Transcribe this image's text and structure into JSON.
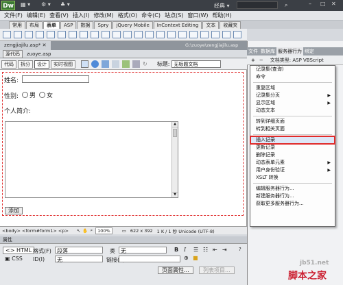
{
  "app": {
    "logo": "Dw",
    "workspace": "经典 ▾"
  },
  "menu": [
    "文件(F)",
    "编辑(E)",
    "查看(V)",
    "插入(I)",
    "修改(M)",
    "格式(O)",
    "命令(C)",
    "站点(S)",
    "窗口(W)",
    "帮助(H)"
  ],
  "insert_tabs": [
    "常用",
    "布局",
    "表单",
    "ASP",
    "数据",
    "Spry",
    "jQuery Mobile",
    "InContext Editing",
    "文本",
    "收藏夹"
  ],
  "active_insert_tab": "表单",
  "doc_tab": "zengjiajilu.asp*",
  "doc_path": "G:\\zuoye\\zengjiajilu.asp",
  "related_files": [
    "源代码",
    "zuoye.asp"
  ],
  "view_buttons": [
    "代码",
    "拆分",
    "设计",
    "实时视图"
  ],
  "title_label": "标题:",
  "title_value": "无标题文档",
  "form": {
    "name_label": "姓名:",
    "gender_label": "性别:",
    "male": "男",
    "female": "女",
    "intro_label": "个人简介:",
    "submit": "添加"
  },
  "status": {
    "tags": "<body> <form#form1> <p>",
    "zoom": "100%",
    "size": "622 x 392",
    "info": "1 K / 1 秒 Unicode (UTF-8)"
  },
  "props": {
    "header": "属性",
    "html": "HTML",
    "css": "CSS",
    "format_label": "格式(F)",
    "format_value": "段落",
    "class_label": "类",
    "class_value": "无",
    "id_label": "ID(I)",
    "id_value": "无",
    "link_label": "链接(L)",
    "page_props": "页面属性...",
    "list_item": "列表项目..."
  },
  "panel_tabs": [
    "文件",
    "数据库",
    "服务器行为",
    "绑定"
  ],
  "panel_doc_type": "文档类型: ASP VBScript",
  "context_menu": [
    {
      "label": "记录集(查询)"
    },
    {
      "label": "命令"
    },
    {
      "sep": true
    },
    {
      "label": "重复区域"
    },
    {
      "label": "记录集分页",
      "sub": true
    },
    {
      "label": "显示区域",
      "sub": true
    },
    {
      "label": "动态文本"
    },
    {
      "sep": true
    },
    {
      "label": "转到详细页面"
    },
    {
      "label": "转到相关页面"
    },
    {
      "sep": true
    },
    {
      "label": "插入记录",
      "highlight": true
    },
    {
      "label": "更新记录"
    },
    {
      "label": "删除记录"
    },
    {
      "label": "动态表单元素",
      "sub": true
    },
    {
      "label": "用户身份验证",
      "sub": true
    },
    {
      "label": "XSLT 转换"
    },
    {
      "sep": true
    },
    {
      "label": "编辑服务器行为..."
    },
    {
      "label": "新建服务器行为..."
    },
    {
      "label": "获取更多服务器行为..."
    }
  ],
  "watermark": {
    "site": "jb51.net",
    "name": "脚本之家"
  },
  "colors": {
    "highlight": "#e02a2a",
    "form_border": "#e03030",
    "titlebar": "#3b3f45"
  }
}
